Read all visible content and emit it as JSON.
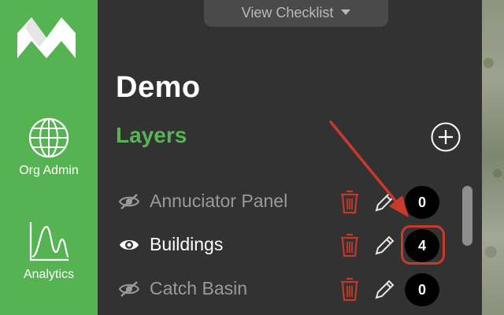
{
  "nav": {
    "items": [
      {
        "label": "Org Admin",
        "icon": "globe-icon"
      },
      {
        "label": "Analytics",
        "icon": "chart-icon"
      }
    ]
  },
  "toolbar": {
    "checklist_label": "View Checklist"
  },
  "project": {
    "title": "Demo"
  },
  "layers": {
    "title": "Layers",
    "items": [
      {
        "name": "Annuciator Panel",
        "count": "0",
        "visible": false
      },
      {
        "name": "Buildings",
        "count": "4",
        "visible": true
      },
      {
        "name": "Catch Basin",
        "count": "0",
        "visible": false
      }
    ]
  },
  "colors": {
    "brand_green": "#55b352",
    "panel_bg": "#323232",
    "delete_red": "#c0392b",
    "annotation_red": "#c93a2a"
  }
}
